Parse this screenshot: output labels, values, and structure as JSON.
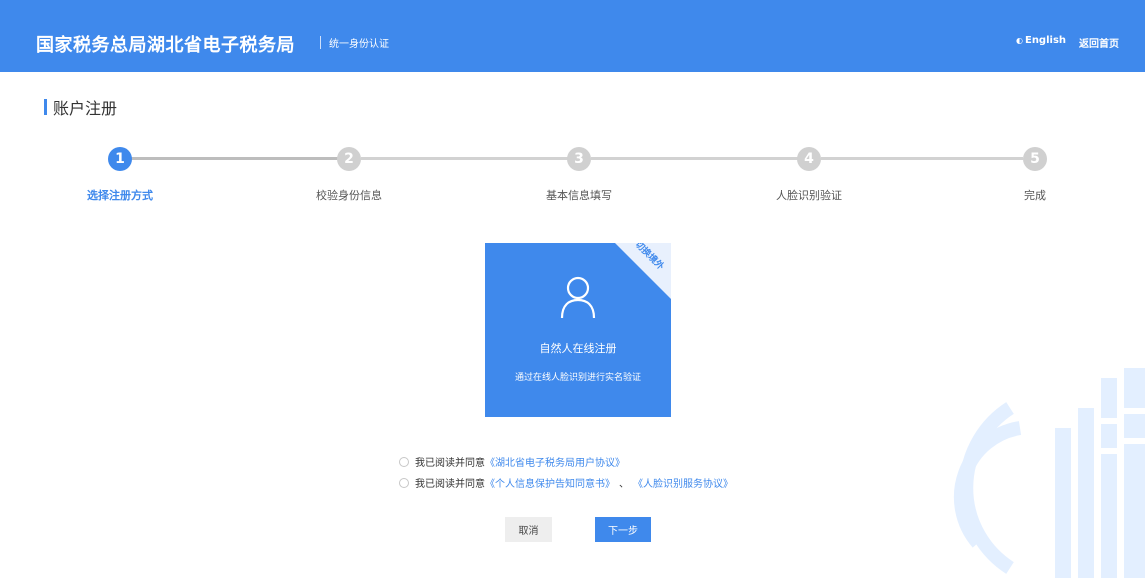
{
  "header": {
    "title": "国家税务总局湖北省电子税务局",
    "subtitle": "统一身份认证",
    "lang_icon": "globe-icon",
    "lang_label": "English",
    "home_label": "返回首页"
  },
  "page": {
    "title": "账户注册"
  },
  "steps": [
    {
      "number": "1",
      "label": "选择注册方式",
      "active": true
    },
    {
      "number": "2",
      "label": "校验身份信息",
      "active": false
    },
    {
      "number": "3",
      "label": "基本信息填写",
      "active": false
    },
    {
      "number": "4",
      "label": "人脸识别验证",
      "active": false
    },
    {
      "number": "5",
      "label": "完成",
      "active": false
    }
  ],
  "card": {
    "corner_label": "切换境外",
    "icon": "user-icon",
    "title": "自然人在线注册",
    "description": "通过在线人脸识别进行实名验证"
  },
  "agreements": [
    {
      "prefix": "我已阅读并同意",
      "links": [
        "《湖北省电子税务局用户协议》"
      ]
    },
    {
      "prefix": "我已阅读并同意",
      "links": [
        "《个人信息保护告知同意书》",
        "《人脸识别服务协议》"
      ],
      "separator": "、"
    }
  ],
  "buttons": {
    "cancel": "取消",
    "next": "下一步"
  },
  "colors": {
    "primary": "#3f89ec",
    "inactive_step": "#d0d0d0",
    "watermark": "#e3efff"
  }
}
